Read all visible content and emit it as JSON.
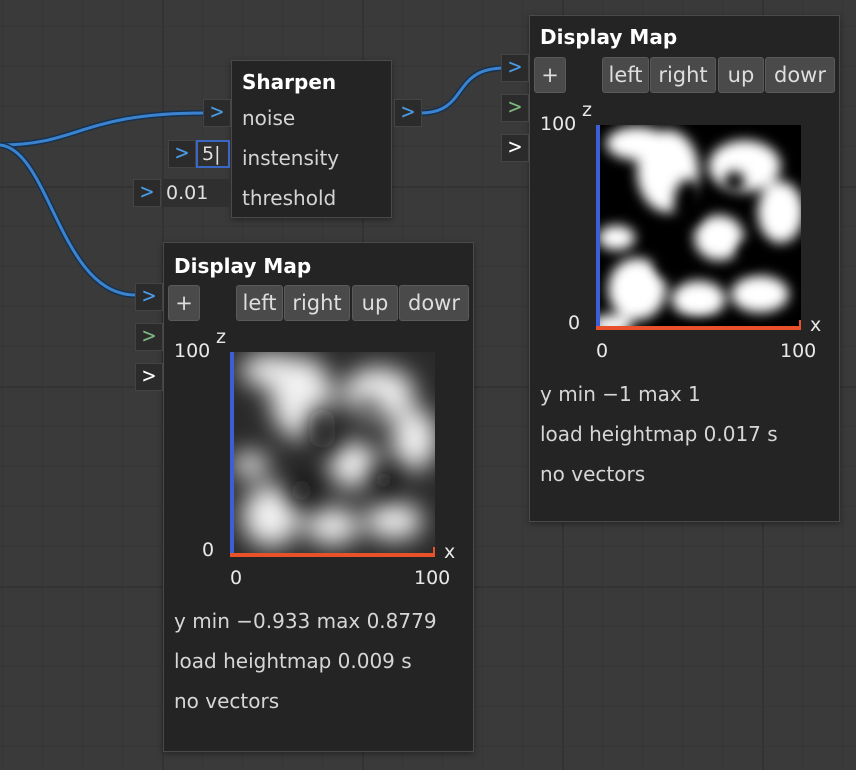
{
  "sharpen": {
    "title": "Sharpen",
    "inputs": [
      "noise",
      "instensity",
      "threshold"
    ],
    "intensity_value": "5|",
    "threshold_value": "0.01"
  },
  "display_map_small": {
    "title": "Display Map",
    "buttons": {
      "add": "+",
      "left": "left",
      "right": "right",
      "up": "up",
      "down": "dowr"
    },
    "axis": {
      "z_label": "z",
      "x_label": "x",
      "z_max": "100",
      "z_min": "0",
      "x_min": "0",
      "x_max": "100"
    },
    "stats": {
      "y_range": "y min −0.933 max 0.8779",
      "load": "load heightmap 0.009 s",
      "vectors": "no vectors"
    }
  },
  "display_map_large": {
    "title": "Display Map",
    "buttons": {
      "add": "+",
      "left": "left",
      "right": "right",
      "up": "up",
      "down": "dowr"
    },
    "axis": {
      "z_label": "z",
      "x_label": "x",
      "z_max": "100",
      "z_min": "0",
      "x_min": "0",
      "x_max": "100"
    },
    "stats": {
      "y_range": "y min −1 max 1",
      "load": "load heightmap 0.017 s",
      "vectors": "no vectors"
    }
  },
  "colors": {
    "wire": "#3c83cf",
    "port_blue": "#4a9de6",
    "port_green": "#7fb77f",
    "axis_z": "#3a5fd6",
    "axis_x": "#e8512a"
  }
}
